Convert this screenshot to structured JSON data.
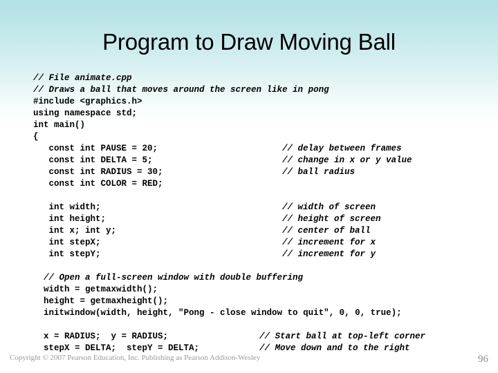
{
  "slide": {
    "title": "Program to Draw Moving Ball",
    "background_top_color": "#b3e1e5",
    "background_bottom_color": "#ffffff"
  },
  "code": {
    "lines": [
      {
        "text": "// File animate.cpp",
        "comment": true,
        "right": "",
        "indent": 0
      },
      {
        "text": "// Draws a ball that moves around the screen like in pong",
        "comment": true,
        "right": "",
        "indent": 0
      },
      {
        "text": "#include <graphics.h>",
        "comment": false,
        "right": "",
        "indent": 0
      },
      {
        "text": "using namespace std;",
        "comment": false,
        "right": "",
        "indent": 0
      },
      {
        "text": "int main()",
        "comment": false,
        "right": "",
        "indent": 0
      },
      {
        "text": "{",
        "comment": false,
        "right": "",
        "indent": 0
      },
      {
        "text": "   const int PAUSE = 20;",
        "comment": false,
        "right": "// delay between frames",
        "indent": 0
      },
      {
        "text": "   const int DELTA = 5;",
        "comment": false,
        "right": "// change in x or y value",
        "indent": 0
      },
      {
        "text": "   const int RADIUS = 30;",
        "comment": false,
        "right": "// ball radius",
        "indent": 0
      },
      {
        "text": "   const int COLOR = RED;",
        "comment": false,
        "right": "",
        "indent": 0
      },
      {
        "text": "",
        "comment": false,
        "right": "",
        "indent": 0
      },
      {
        "text": "   int width;",
        "comment": false,
        "right": "// width of screen",
        "indent": 0
      },
      {
        "text": "   int height;",
        "comment": false,
        "right": "// height of screen",
        "indent": 0
      },
      {
        "text": "   int x; int y;",
        "comment": false,
        "right": "// center of ball",
        "indent": 0
      },
      {
        "text": "   int stepX;",
        "comment": false,
        "right": "// increment for x",
        "indent": 0
      },
      {
        "text": "   int stepY;",
        "comment": false,
        "right": "// increment for y",
        "indent": 0
      },
      {
        "text": "",
        "comment": false,
        "right": "",
        "indent": 0
      },
      {
        "text": "  // Open a full-screen window with double buffering",
        "comment": true,
        "right": "",
        "indent": 0
      },
      {
        "text": "  width = getmaxwidth();",
        "comment": false,
        "right": "",
        "indent": 0
      },
      {
        "text": "  height = getmaxheight();",
        "comment": false,
        "right": "",
        "indent": 0
      },
      {
        "text": "  initwindow(width, height, \"Pong - close window to quit\", 0, 0, true);",
        "comment": false,
        "right": "",
        "indent": 0
      },
      {
        "text": "",
        "comment": false,
        "right": "",
        "indent": 0
      },
      {
        "text": "  x = RADIUS;  y = RADIUS;",
        "comment": false,
        "right": "// Start ball at top-left corner",
        "indent": 0,
        "right_col": "b"
      },
      {
        "text": "  stepX = DELTA;  stepY = DELTA;",
        "comment": false,
        "right": "// Move down and to the right",
        "indent": 0,
        "right_col": "b"
      }
    ]
  },
  "footer": {
    "copyright": "Copyright © 2007 Pearson Education, Inc. Publishing as Pearson Addison-Wesley",
    "page_number": "96"
  }
}
